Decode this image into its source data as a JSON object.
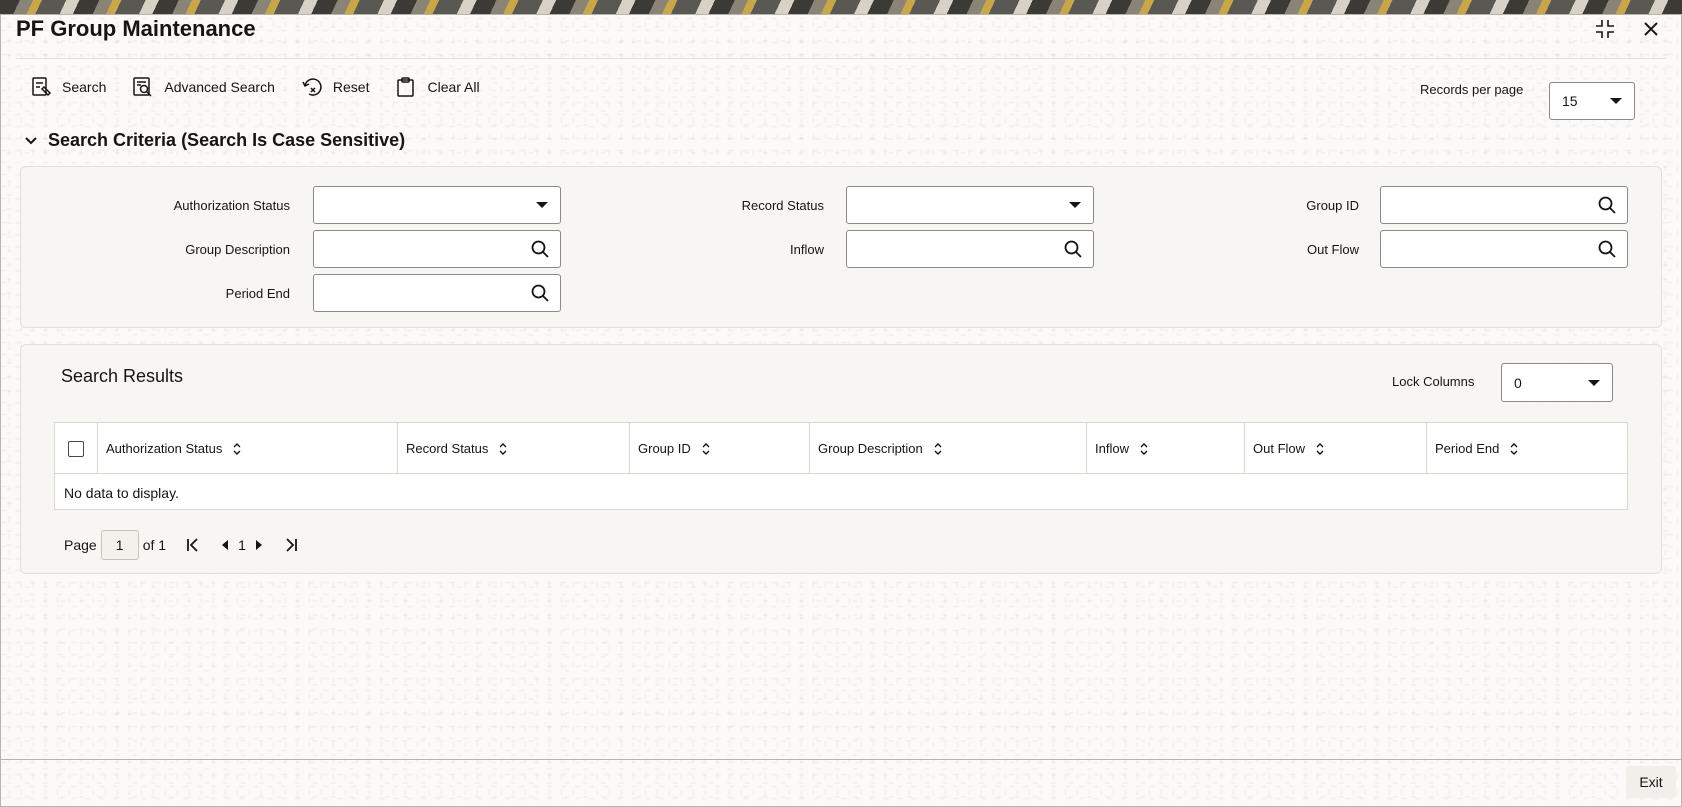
{
  "window": {
    "title": "PF Group Maintenance",
    "icons": [
      "collapse-icon",
      "close-icon"
    ]
  },
  "toolbar": {
    "search_label": "Search",
    "advanced_search_label": "Advanced Search",
    "reset_label": "Reset",
    "clear_all_label": "Clear All",
    "records_per_page_label": "Records per page",
    "records_per_page_value": "15"
  },
  "criteria": {
    "heading": "Search Criteria (Search Is Case Sensitive)",
    "fields": {
      "authorization_status": {
        "label": "Authorization Status",
        "value": ""
      },
      "record_status": {
        "label": "Record Status",
        "value": ""
      },
      "group_id": {
        "label": "Group ID",
        "value": ""
      },
      "group_description": {
        "label": "Group Description",
        "value": ""
      },
      "inflow": {
        "label": "Inflow",
        "value": ""
      },
      "out_flow": {
        "label": "Out Flow",
        "value": ""
      },
      "period_end": {
        "label": "Period End",
        "value": ""
      }
    }
  },
  "results": {
    "heading": "Search Results",
    "lock_columns_label": "Lock Columns",
    "lock_columns_value": "0",
    "columns": [
      "Authorization Status",
      "Record Status",
      "Group ID",
      "Group Description",
      "Inflow",
      "Out Flow",
      "Period End"
    ],
    "empty_text": "No data to display."
  },
  "pager": {
    "page_label": "Page",
    "current_page": "1",
    "of_label": "of 1",
    "page_number": "1"
  },
  "footer": {
    "exit_label": "Exit"
  },
  "colors": {
    "text": "#161513",
    "border": "#8d8a84",
    "panel_bg": "#f7f5f1"
  }
}
